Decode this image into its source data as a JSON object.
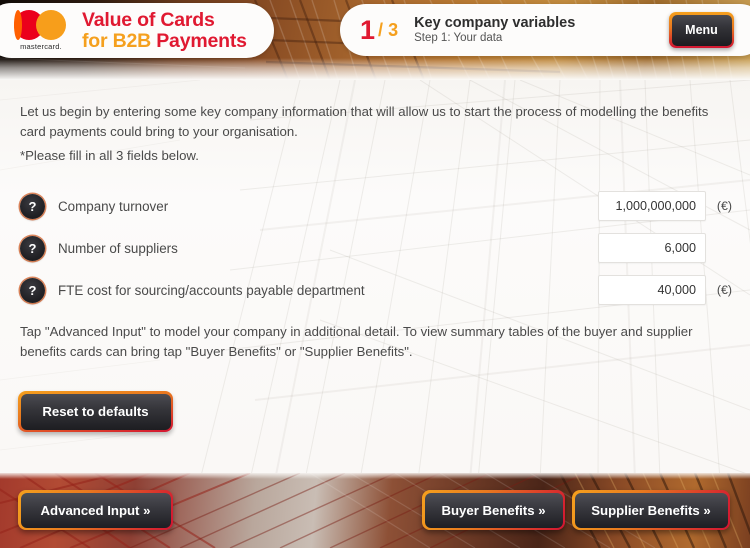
{
  "header": {
    "brand": {
      "logo_icon": "mastercard-logo-icon",
      "logo_wordmark": "mastercard.",
      "title_line1": "Value of Cards",
      "title_line2_orange": "for B2B",
      "title_line2_red": " Payments"
    },
    "step": {
      "current": "1",
      "separator": "/",
      "total": "3",
      "title": "Key company variables",
      "subtitle": "Step 1: Your data"
    },
    "menu_label": "Menu"
  },
  "main": {
    "intro_paragraph": "Let us begin by entering some key company information that will allow us to start the process of modelling the benefits card payments could bring to your organisation.",
    "note_paragraph": "*Please fill in all 3 fields below.",
    "fields": [
      {
        "help_icon": "question-mark-icon",
        "label": "Company turnover",
        "value": "1,000,000,000",
        "unit": "(€)"
      },
      {
        "help_icon": "question-mark-icon",
        "label": "Number of suppliers",
        "value": "6,000",
        "unit": ""
      },
      {
        "help_icon": "question-mark-icon",
        "label": "FTE cost for sourcing/accounts payable department",
        "value": "40,000",
        "unit": "(€)"
      }
    ],
    "tap_paragraph": "Tap \"Advanced Input\" to model your company in additional detail. To view summary tables of the buyer and supplier benefits cards can bring tap \"Buyer Benefits\" or \"Supplier Benefits\".",
    "reset_label": "Reset to defaults"
  },
  "footer": {
    "advanced_input_label": "Advanced Input »",
    "buyer_benefits_label": "Buyer Benefits »",
    "supplier_benefits_label": "Supplier Benefits »"
  },
  "colors": {
    "brand_red": "#E01931",
    "brand_orange": "#F5A01E",
    "mastercard_red": "#EB001B",
    "mastercard_orange": "#F79E1B",
    "mastercard_overlap": "#FF5F00",
    "text_gray": "#4a4a4a",
    "button_dark": "#1e1e23"
  }
}
